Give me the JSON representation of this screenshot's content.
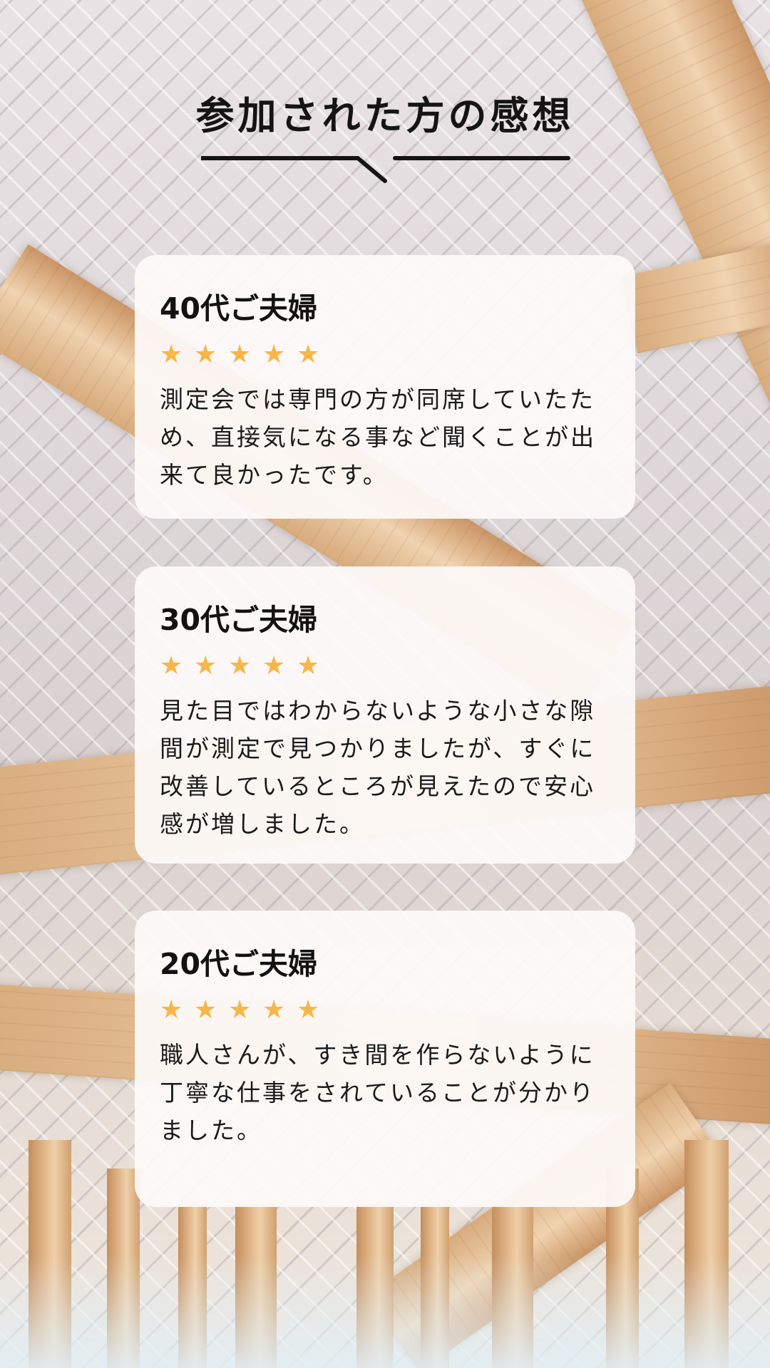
{
  "page": {
    "heading": "参加された方の感想"
  },
  "colors": {
    "star": "#f6b64a",
    "card_background": "#fdfaf9",
    "heading_text": "#141414",
    "beam_wood": "#e6c39b"
  },
  "reviews": [
    {
      "reviewer": "40代ご夫婦",
      "rating": 5,
      "comment": "測定会では専門の方が同席していたため、直接気になる事など聞くことが出来て良かったです。"
    },
    {
      "reviewer": "30代ご夫婦",
      "rating": 5,
      "comment": "見た目ではわからないような小さな隙間が測定で見つかりましたが、すぐに改善しているところが見えたので安心感が増しました。"
    },
    {
      "reviewer": "20代ご夫婦",
      "rating": 5,
      "comment": "職人さんが、すき間を作らないように丁寧な仕事をされていることが分かりました。"
    }
  ],
  "icons": {
    "star": "star-icon",
    "heading_decoration": "speech-tail-underline"
  }
}
